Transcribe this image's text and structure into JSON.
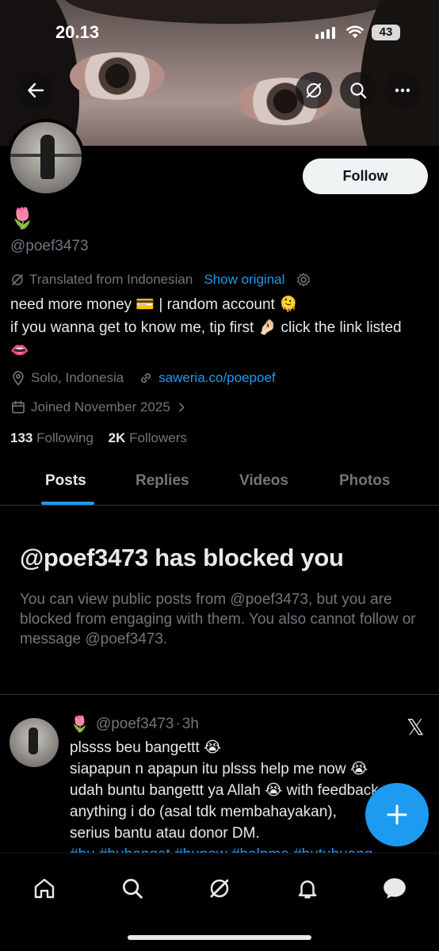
{
  "status_bar": {
    "time": "20.13",
    "battery": "43"
  },
  "profile": {
    "name_emoji": "🌷",
    "handle": "@poef3473",
    "follow_label": "Follow",
    "translation_note": "Translated from Indonesian",
    "show_original_label": "Show original",
    "bio_line1": "need more money 💳 | random account 🫠",
    "bio_line2": "if you wanna get to know me, tip first 🤌🏻 click the link listed 👄",
    "location": "Solo, Indonesia",
    "website": "saweria.co/poepoef",
    "joined": "Joined November 2025",
    "following_count": "133",
    "following_label": "Following",
    "followers_count": "2K",
    "followers_label": "Followers"
  },
  "tabs": [
    "Posts",
    "Replies",
    "Videos",
    "Photos"
  ],
  "blocked": {
    "title": "@poef3473 has blocked you",
    "description": "You can view public posts from @poef3473, but you are blocked from engaging with them. You also cannot follow or message @poef3473."
  },
  "post": {
    "name_emoji": "🌷",
    "handle": "@poef3473",
    "separator": "·",
    "time": "3h",
    "line1": "plssss beu bangettt 😭",
    "line2": "siapapun n apapun itu plsss help me now 😭",
    "line3": "udah buntu bangettt ya Allah 😭 with feedback",
    "line4": "anything i do (asal tdk membahayakan),",
    "line5": "serius bantu atau donor DM.",
    "hashtags": "#bu #bubanget #bunow #helpme #butuhuang"
  },
  "colors": {
    "accent": "#1d9bf0",
    "muted": "#71767b",
    "text": "#e7e9ea",
    "background": "#000000"
  },
  "icons": [
    "back-arrow-icon",
    "grok-icon",
    "search-icon",
    "more-icon",
    "settings-gear-icon",
    "location-pin-icon",
    "link-icon",
    "calendar-icon",
    "chevron-right-icon",
    "x-logo-icon",
    "compose-plus-icon",
    "home-icon",
    "messages-icon",
    "notifications-icon"
  ]
}
